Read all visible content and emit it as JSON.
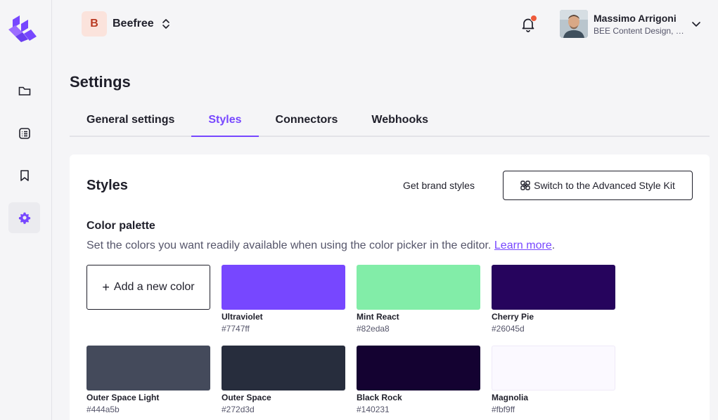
{
  "workspace": {
    "initial": "B",
    "name": "Beefree"
  },
  "user": {
    "name": "Massimo Arrigoni",
    "org": "BEE Content Design, Inc."
  },
  "page": {
    "title": "Settings"
  },
  "tabs": [
    {
      "label": "General settings"
    },
    {
      "label": "Styles"
    },
    {
      "label": "Connectors"
    },
    {
      "label": "Webhooks"
    }
  ],
  "styles": {
    "title": "Styles",
    "brand_link": "Get brand styles",
    "advanced_button": "Switch to the Advanced Style Kit"
  },
  "palette": {
    "title": "Color palette",
    "description": "Set the colors you want readily available when using the color picker in the editor.",
    "learn_more": "Learn more",
    "period": ".",
    "add_label": "Add a new color",
    "colors": [
      {
        "name": "Ultraviolet",
        "hex": "#7747ff"
      },
      {
        "name": "Mint React",
        "hex": "#82eda8"
      },
      {
        "name": "Cherry Pie",
        "hex": "#26045d"
      },
      {
        "name": "Outer Space Light",
        "hex": "#444a5b"
      },
      {
        "name": "Outer Space",
        "hex": "#272d3d"
      },
      {
        "name": "Black Rock",
        "hex": "#140231"
      },
      {
        "name": "Magnolia",
        "hex": "#fbf9ff"
      }
    ]
  },
  "icons": {
    "logo": "beefree-logo-icon",
    "nav": [
      "folder-icon",
      "list-icon",
      "bookmark-icon",
      "gear-icon"
    ],
    "notification": "bell-icon",
    "workspace_switch": "chevron-updown-icon",
    "user_menu": "chevron-down-icon"
  },
  "colors": {
    "accent": "#7747ff",
    "notification_dot": "#ee5a3a",
    "workspace_bg": "#fbe3dc",
    "workspace_text": "#b93a22"
  }
}
